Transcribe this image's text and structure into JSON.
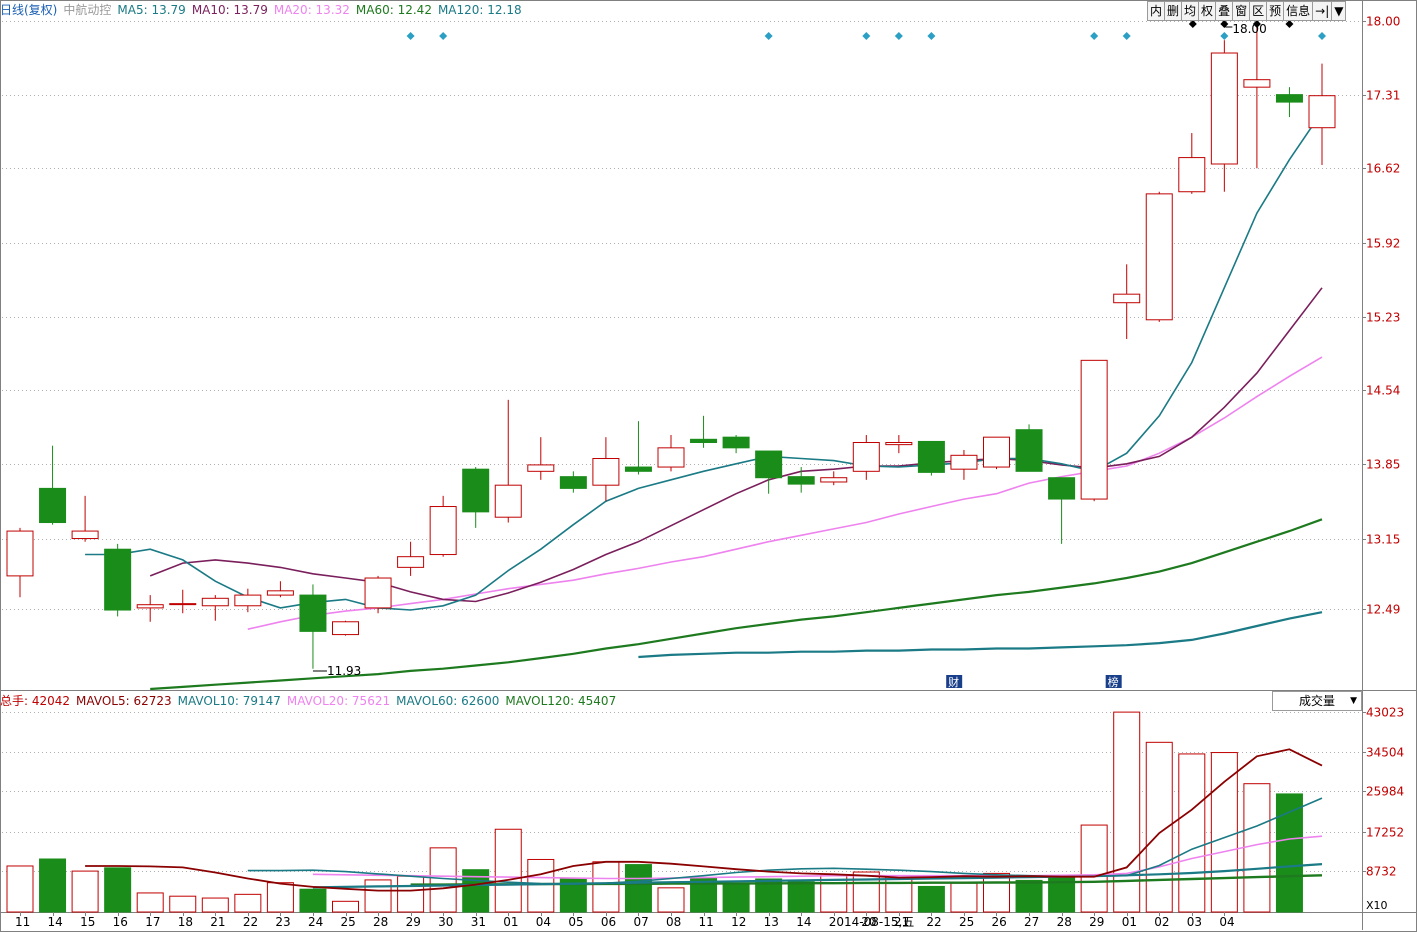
{
  "header": {
    "period": "日线(复权)",
    "stock_name": "中航动控",
    "ma5": "MA5: 13.79",
    "ma10": "MA10: 13.79",
    "ma20": "MA20: 13.32",
    "ma60": "MA60: 12.42",
    "ma120": "MA120: 12.18"
  },
  "toolbar": [
    "内",
    "删",
    "均",
    "权",
    "叠",
    "窗",
    "区",
    "预",
    "信息",
    "→|",
    "▼"
  ],
  "volume_header": {
    "total": "总手: 42042",
    "mavol5": "MAVOL5: 62723",
    "mavol10": "MAVOL10: 79147",
    "mavol20": "MAVOL20: 75621",
    "mavol60": "MAVOL60: 62600",
    "mavol120": "MAVOL120: 45407"
  },
  "indicator_select": "成交量",
  "volume_unit": "X10",
  "colors": {
    "up": "#c00000",
    "down": "#1a8c1a",
    "ma5": "#1a7a85",
    "ma10": "#7a1f5c",
    "ma20": "#ee82ee",
    "ma60": "#1e7a1e",
    "ma120": "#1a7a85",
    "mavol5": "#8b0000",
    "grid": "#b0b0b0",
    "axis_text": "#c00000",
    "marker": "#2b9fc4"
  },
  "chart_data": {
    "type": "candlestick",
    "y_ticks": [
      "18.00",
      "17.31",
      "16.62",
      "15.92",
      "15.23",
      "14.54",
      "13.85",
      "13.15",
      "12.49"
    ],
    "vol_ticks": [
      "43023",
      "34504",
      "25984",
      "17252",
      "8732"
    ],
    "x_labels": [
      "11",
      "14",
      "15",
      "16",
      "17",
      "18",
      "21",
      "22",
      "23",
      "24",
      "25",
      "28",
      "29",
      "30",
      "31",
      "01",
      "04",
      "05",
      "06",
      "07",
      "08",
      "11",
      "12",
      "13",
      "14",
      "2014-08-15,五",
      "20",
      "21",
      "22",
      "25",
      "26",
      "27",
      "28",
      "29",
      "01",
      "02",
      "03",
      "04"
    ],
    "candles": [
      {
        "o": 12.8,
        "h": 13.25,
        "l": 12.6,
        "c": 13.22
      },
      {
        "o": 13.62,
        "h": 14.02,
        "l": 13.28,
        "c": 13.3
      },
      {
        "o": 13.15,
        "h": 13.55,
        "l": 13.12,
        "c": 13.22
      },
      {
        "o": 13.05,
        "h": 13.1,
        "l": 12.42,
        "c": 12.48
      },
      {
        "o": 12.5,
        "h": 12.62,
        "l": 12.37,
        "c": 12.53
      },
      {
        "o": 12.54,
        "h": 12.67,
        "l": 12.45,
        "c": 12.54
      },
      {
        "o": 12.52,
        "h": 12.62,
        "l": 12.38,
        "c": 12.59
      },
      {
        "o": 12.52,
        "h": 12.68,
        "l": 12.46,
        "c": 12.62
      },
      {
        "o": 12.62,
        "h": 12.75,
        "l": 12.6,
        "c": 12.66
      },
      {
        "o": 12.62,
        "h": 12.72,
        "l": 11.93,
        "c": 12.28
      },
      {
        "o": 12.25,
        "h": 12.38,
        "l": 12.24,
        "c": 12.37
      },
      {
        "o": 12.5,
        "h": 12.8,
        "l": 12.45,
        "c": 12.78
      },
      {
        "o": 12.88,
        "h": 13.12,
        "l": 12.8,
        "c": 12.98
      },
      {
        "o": 13.0,
        "h": 13.55,
        "l": 12.98,
        "c": 13.45
      },
      {
        "o": 13.8,
        "h": 13.82,
        "l": 13.25,
        "c": 13.4
      },
      {
        "o": 13.35,
        "h": 14.45,
        "l": 13.3,
        "c": 13.65
      },
      {
        "o": 13.78,
        "h": 14.1,
        "l": 13.7,
        "c": 13.84
      },
      {
        "o": 13.73,
        "h": 13.78,
        "l": 13.58,
        "c": 13.62
      },
      {
        "o": 13.65,
        "h": 14.1,
        "l": 13.5,
        "c": 13.9
      },
      {
        "o": 13.82,
        "h": 14.25,
        "l": 13.75,
        "c": 13.78
      },
      {
        "o": 13.82,
        "h": 14.12,
        "l": 13.78,
        "c": 14.0
      },
      {
        "o": 14.08,
        "h": 14.3,
        "l": 14.0,
        "c": 14.05
      },
      {
        "o": 14.1,
        "h": 14.12,
        "l": 13.95,
        "c": 14.0
      },
      {
        "o": 13.97,
        "h": 13.97,
        "l": 13.57,
        "c": 13.72
      },
      {
        "o": 13.73,
        "h": 13.82,
        "l": 13.58,
        "c": 13.66
      },
      {
        "o": 13.68,
        "h": 13.78,
        "l": 13.65,
        "c": 13.72
      },
      {
        "o": 13.78,
        "h": 14.12,
        "l": 13.7,
        "c": 14.05
      },
      {
        "o": 14.03,
        "h": 14.12,
        "l": 13.95,
        "c": 14.05
      },
      {
        "o": 14.06,
        "h": 14.06,
        "l": 13.74,
        "c": 13.77
      },
      {
        "o": 13.8,
        "h": 13.98,
        "l": 13.7,
        "c": 13.93
      },
      {
        "o": 13.82,
        "h": 14.1,
        "l": 13.8,
        "c": 14.1
      },
      {
        "o": 14.17,
        "h": 14.22,
        "l": 13.78,
        "c": 13.78
      },
      {
        "o": 13.72,
        "h": 13.72,
        "l": 13.1,
        "c": 13.52
      },
      {
        "o": 13.52,
        "h": 14.82,
        "l": 13.5,
        "c": 14.82
      },
      {
        "o": 15.36,
        "h": 15.72,
        "l": 15.02,
        "c": 15.44
      },
      {
        "o": 15.2,
        "h": 16.4,
        "l": 15.18,
        "c": 16.38
      },
      {
        "o": 16.4,
        "h": 16.95,
        "l": 16.38,
        "c": 16.72
      },
      {
        "o": 16.66,
        "h": 17.82,
        "l": 16.4,
        "c": 17.7
      },
      {
        "o": 17.38,
        "h": 18.0,
        "l": 16.62,
        "c": 17.45
      },
      {
        "o": 17.31,
        "h": 17.38,
        "l": 17.1,
        "c": 17.24
      },
      {
        "o": 17.0,
        "h": 17.6,
        "l": 16.65,
        "c": 17.3
      }
    ],
    "ma5": [
      13.0,
      13.0,
      13.05,
      12.95,
      12.75,
      12.6,
      12.5,
      12.55,
      12.58,
      12.5,
      12.48,
      12.52,
      12.62,
      12.85,
      13.05,
      13.28,
      13.5,
      13.62,
      13.7,
      13.78,
      13.85,
      13.92,
      13.9,
      13.88,
      13.83,
      13.82,
      13.84,
      13.86,
      13.9,
      13.9,
      13.85,
      13.78,
      13.95,
      14.3,
      14.8,
      15.5,
      16.2,
      16.7,
      17.15
    ],
    "ma10": [
      12.8,
      12.92,
      12.95,
      12.92,
      12.88,
      12.82,
      12.78,
      12.74,
      12.65,
      12.58,
      12.56,
      12.64,
      12.74,
      12.86,
      13.0,
      13.12,
      13.27,
      13.42,
      13.57,
      13.7,
      13.78,
      13.8,
      13.83,
      13.83,
      13.86,
      13.88,
      13.9,
      13.88,
      13.84,
      13.81,
      13.85,
      13.92,
      14.1,
      14.38,
      14.7,
      15.1,
      15.5
    ],
    "ma20": [
      12.3,
      12.37,
      12.43,
      12.47,
      12.5,
      12.54,
      12.58,
      12.63,
      12.68,
      12.72,
      12.76,
      12.82,
      12.87,
      12.93,
      12.98,
      13.05,
      13.12,
      13.18,
      13.24,
      13.3,
      13.38,
      13.45,
      13.52,
      13.57,
      13.67,
      13.73,
      13.78,
      13.83,
      13.95,
      14.1,
      14.28,
      14.48,
      14.67,
      14.85
    ],
    "ma60": [
      11.74,
      11.76,
      11.78,
      11.8,
      11.82,
      11.84,
      11.86,
      11.88,
      11.91,
      11.93,
      11.96,
      11.99,
      12.03,
      12.07,
      12.12,
      12.16,
      12.21,
      12.26,
      12.31,
      12.35,
      12.39,
      12.42,
      12.46,
      12.5,
      12.54,
      12.58,
      12.62,
      12.65,
      12.69,
      12.73,
      12.78,
      12.84,
      12.92,
      13.02,
      13.12,
      13.22,
      13.33
    ],
    "ma120": [
      12.04,
      12.06,
      12.07,
      12.08,
      12.08,
      12.09,
      12.09,
      12.1,
      12.1,
      12.11,
      12.11,
      12.12,
      12.12,
      12.13,
      12.14,
      12.15,
      12.17,
      12.2,
      12.26,
      12.33,
      12.4,
      12.46
    ],
    "volumes": [
      9900,
      11400,
      8800,
      9500,
      4100,
      3400,
      3000,
      3800,
      6300,
      4900,
      2300,
      6900,
      7700,
      13800,
      9100,
      17800,
      11300,
      7300,
      10800,
      10200,
      5200,
      7300,
      6100,
      7100,
      6500,
      7800,
      8600,
      7800,
      5500,
      6200,
      8300,
      6800,
      7700,
      18700,
      43000,
      36500,
      34000,
      34300,
      27600,
      25400
    ],
    "mavol5": [
      9900,
      9900,
      9800,
      9600,
      8500,
      7200,
      6100,
      5400,
      5000,
      4600,
      4600,
      5100,
      5900,
      6900,
      8100,
      9900,
      10800,
      10800,
      10400,
      9800,
      9200,
      8700,
      8300,
      8100,
      7800,
      7400,
      7500,
      7700,
      7600,
      7700,
      7600,
      7600,
      9600,
      17000,
      22000,
      28000,
      33500,
      35000,
      31500
    ],
    "mavol10": [
      8900,
      8900,
      9000,
      8700,
      8200,
      7700,
      7200,
      6800,
      6400,
      6100,
      6000,
      6200,
      6600,
      7200,
      7800,
      8500,
      9000,
      9300,
      9400,
      9200,
      9000,
      8700,
      8300,
      8000,
      7800,
      7600,
      7700,
      7800,
      10000,
      13500,
      16000,
      18500,
      21500,
      24500
    ],
    "mavol20": [
      8100,
      8000,
      7900,
      7800,
      7700,
      7600,
      7500,
      7400,
      7300,
      7200,
      7200,
      7300,
      7400,
      7500,
      7600,
      7700,
      7800,
      7800,
      7800,
      7800,
      7800,
      7800,
      7800,
      7900,
      8000,
      8300,
      9700,
      11500,
      13000,
      14500,
      15700,
      16300
    ],
    "mavol60": [
      5300,
      5400,
      5500,
      5600,
      5700,
      5800,
      5900,
      6000,
      6100,
      6200,
      6300,
      6400,
      6500,
      6600,
      6700,
      6800,
      6900,
      7000,
      7100,
      7200,
      7300,
      7400,
      7500,
      7600,
      7700,
      7900,
      8100,
      8400,
      8800,
      9300,
      9800,
      10300
    ],
    "mavol120": [
      5900,
      5900,
      5950,
      5950,
      6000,
      6000,
      6050,
      6050,
      6100,
      6100,
      6150,
      6150,
      6200,
      6200,
      6250,
      6250,
      6300,
      6300,
      6350,
      6350,
      6400,
      6500,
      6700,
      6900,
      7100,
      7300,
      7500,
      7700,
      7900
    ],
    "annotations": {
      "high_label": "18.00",
      "low_label": "11.93",
      "event_cai": "财",
      "event_bang": "榜"
    },
    "ylim": [
      11.74,
      18.0
    ],
    "vol_ylim": [
      0,
      43023
    ]
  }
}
